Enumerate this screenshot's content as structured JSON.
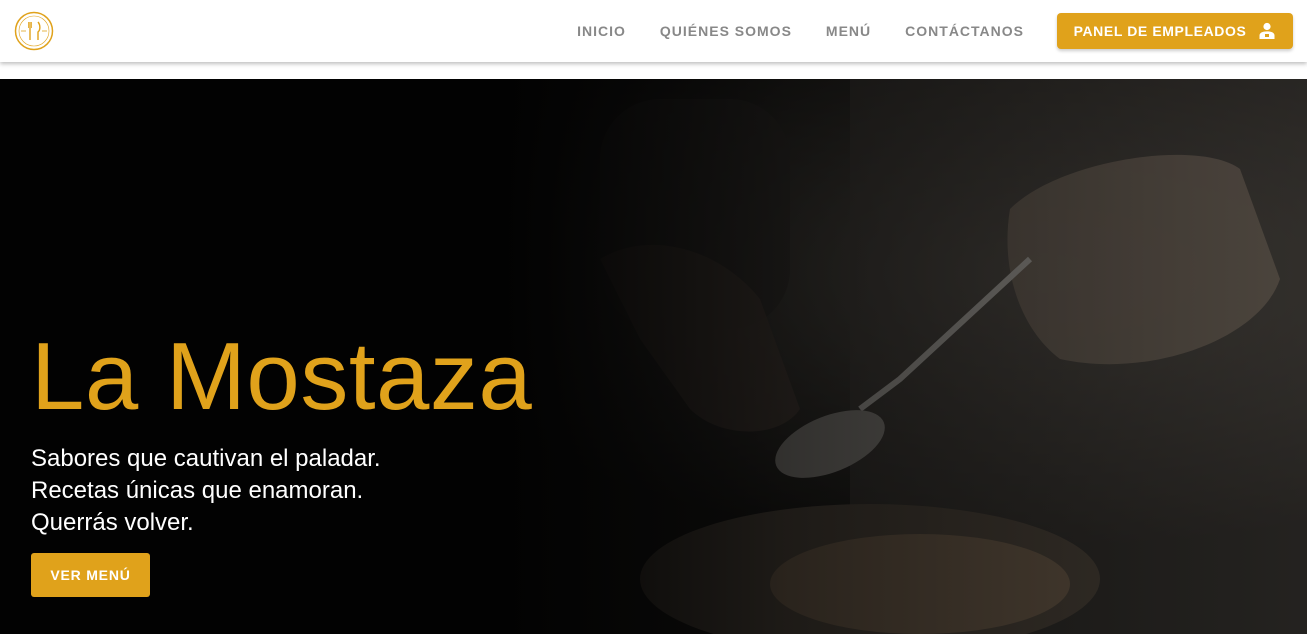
{
  "nav": {
    "logo_icon": "restaurant-logo-icon",
    "links": [
      {
        "label": "INICIO"
      },
      {
        "label": "QUIÉNES SOMOS"
      },
      {
        "label": "MENÚ"
      },
      {
        "label": "CONTÁCTANOS"
      }
    ],
    "panel_button": {
      "label": "PANEL DE EMPLEADOS",
      "icon": "employee-icon"
    }
  },
  "hero": {
    "title": "La Mostaza",
    "tagline": [
      "Sabores que cautivan el paladar.",
      "Recetas únicas que enamoran.",
      "Querrás volver."
    ],
    "cta_label": "VER MENÚ"
  },
  "colors": {
    "accent": "#e0a21b",
    "nav_text": "#888888",
    "hero_bg": "#050505"
  }
}
